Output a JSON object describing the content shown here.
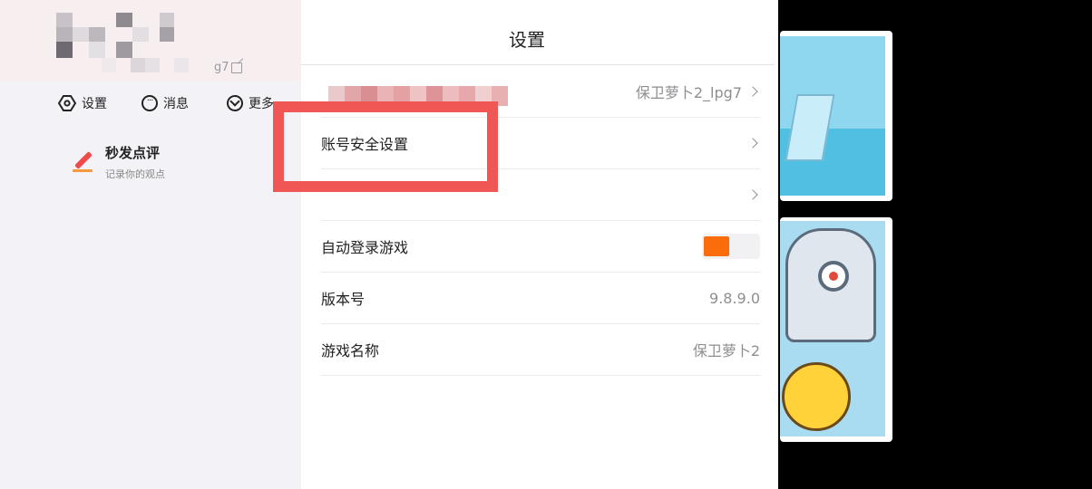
{
  "sidebar": {
    "uid_suffix": "g7",
    "nav": [
      {
        "label": "设置",
        "icon": "gear-icon"
      },
      {
        "label": "消息",
        "icon": "chat-icon"
      },
      {
        "label": "更多",
        "icon": "chevron-down-icon"
      }
    ],
    "review": {
      "title": "秒发点评",
      "subtitle": "记录你的观点",
      "icon": "pen-icon"
    }
  },
  "settings": {
    "title": "设置",
    "rows": [
      {
        "label": "",
        "value": "保卫萝卜2_lpg7",
        "has_chevron": true
      },
      {
        "label": "账号安全设置",
        "value": "",
        "has_chevron": true
      },
      {
        "label": "",
        "value": "",
        "has_chevron": true
      },
      {
        "label": "自动登录游戏",
        "toggle": true,
        "toggle_on": true
      },
      {
        "label": "版本号",
        "value": "9.8.9.0"
      },
      {
        "label": "游戏名称",
        "value": "保卫萝卜2"
      }
    ]
  },
  "colors": {
    "accent_orange": "#fa6d0a",
    "highlight_red": "#f05653",
    "sidebar_bg": "#f3f3f7"
  }
}
